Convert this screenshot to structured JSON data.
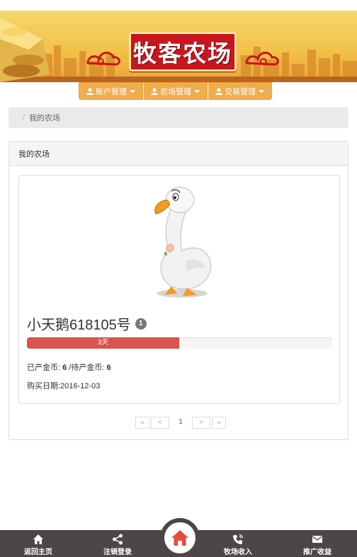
{
  "header": {
    "logo_text": "牧客农场"
  },
  "nav": [
    {
      "label": "账户管理",
      "icon": "user-icon"
    },
    {
      "label": "农场管理",
      "icon": "user-icon"
    },
    {
      "label": "交易管理",
      "icon": "user-icon"
    }
  ],
  "breadcrumb": {
    "separator": "/",
    "current": "我的农场"
  },
  "panel": {
    "title": "我的农场"
  },
  "pet": {
    "name": "小天鹅618105号",
    "badge": "1",
    "progress_label": "3天",
    "progress_fraction": 0.5,
    "produced_label": "已产金币: ",
    "produced_value": "6",
    "pending_label": " /待产金币: ",
    "pending_value": "6",
    "purchase_date": "购买日期:2016-12-03"
  },
  "pagination": {
    "first": "«",
    "prev": "<",
    "current": "1",
    "next": ">",
    "last": "»"
  },
  "footer": {
    "back_home": "返回主页",
    "logout": "注销登录",
    "farm_income": "牧场收入",
    "promo_income": "推广收益"
  },
  "colors": {
    "accent_orange": "#f0ad4e",
    "progress_red": "#d9534f",
    "footer_bg": "#4d4647",
    "home_red": "#e74c3c"
  }
}
